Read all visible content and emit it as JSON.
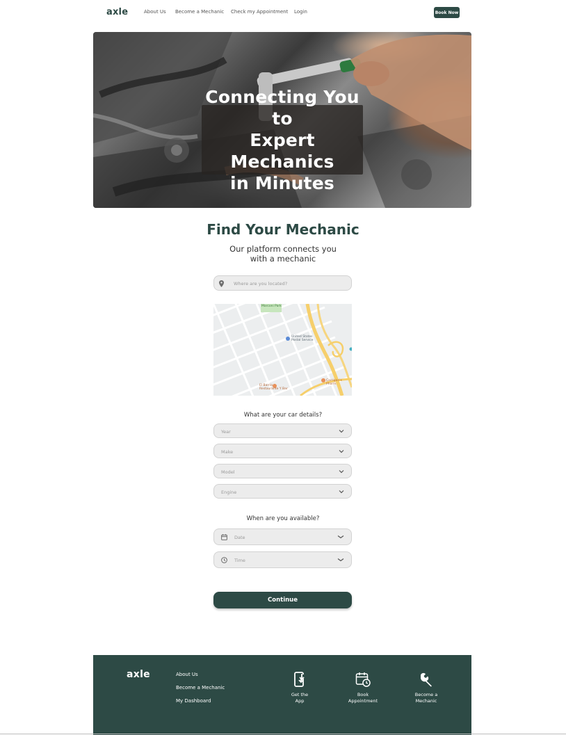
{
  "nav": {
    "logo": "axle",
    "links": [
      "About Us",
      "Become a Mechanic",
      "Check my Appointment",
      "Login"
    ],
    "book_button": "Book Now"
  },
  "hero": {
    "title_line1": "Connecting You to",
    "title_line2": "Expert Mechanics",
    "title_line3": "in Minutes"
  },
  "find": {
    "title": "Find Your Mechanic",
    "subtitle": "Our platform connects you with a mechanic",
    "location_placeholder": "Where are you located?",
    "map_labels": {
      "park": "Marconi Park",
      "postal_line1": "United States",
      "postal_line2": "Postal Service",
      "restaurant_line1": "El Barrio",
      "restaurant_line2": "Restaurante Y Bar",
      "store": "Carrigan's Pharm"
    }
  },
  "car": {
    "question": "What are your car details?",
    "fields": [
      "Year",
      "Make",
      "Model",
      "Engine"
    ]
  },
  "availability": {
    "question": "When are you available?",
    "date_placeholder": "Date",
    "time_placeholder": "Time"
  },
  "continue_button": "Continue",
  "footer": {
    "logo": "axle",
    "links": [
      "About Us",
      "Become a Mechanic",
      "My Dashboard"
    ],
    "actions": [
      {
        "label_line1": "Get the",
        "label_line2": "App",
        "icon": "phone-download-icon"
      },
      {
        "label_line1": "Book",
        "label_line2": "Appointment",
        "icon": "calendar-clock-icon"
      },
      {
        "label_line1": "Become a",
        "label_line2": "Mechanic",
        "icon": "wrench-icon"
      }
    ]
  },
  "colors": {
    "brand": "#2d4a45",
    "field_bg": "#ececec"
  }
}
